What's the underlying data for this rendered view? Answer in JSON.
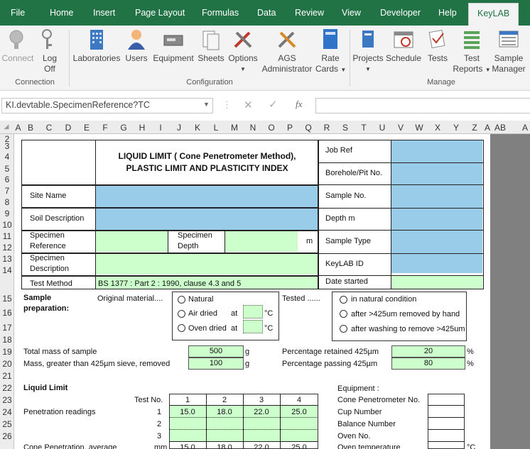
{
  "ribbon_tabs": [
    "File",
    "Home",
    "Insert",
    "Page Layout",
    "Formulas",
    "Data",
    "Review",
    "View",
    "Developer",
    "Help",
    "KeyLAB"
  ],
  "ribbon": {
    "connect": "Connect",
    "logoff_1": "Log",
    "logoff_2": "Off",
    "laboratories": "Laboratories",
    "users": "Users",
    "equipment": "Equipment",
    "sheets": "Sheets",
    "options": "Options",
    "ags_1": "AGS",
    "ags_2": "Administrator",
    "rate_1": "Rate",
    "rate_2": "Cards",
    "projects": "Projects",
    "schedule": "Schedule",
    "tests": "Tests",
    "treports_1": "Test",
    "treports_2": "Reports",
    "smanager_1": "Sample",
    "smanager_2": "Manager",
    "group_connection": "Connection",
    "group_configuration": "Configuration",
    "group_manage": "Manage"
  },
  "formula_bar": {
    "name_box": "KI.devtable.SpecimenReference?TC",
    "fx": "fx"
  },
  "columns": [
    "A",
    "B",
    "C",
    "D",
    "E",
    "F",
    "G",
    "H",
    "I",
    "J",
    "K",
    "L",
    "M",
    "N",
    "O",
    "P",
    "Q",
    "R",
    "S",
    "T",
    "U",
    "V",
    "W",
    "X",
    "Y",
    "Z",
    "A",
    "AB",
    "A"
  ],
  "rows": [
    "2",
    "3",
    "4",
    "5",
    "6",
    "7",
    "8",
    "9",
    "10",
    "11",
    "12",
    "13",
    "14",
    "15",
    "16",
    "17",
    "18",
    "19",
    "20",
    "21",
    "22",
    "23",
    "24",
    "25",
    "26"
  ],
  "sheet": {
    "title_1": "LIQUID LIMIT ( Cone Penetrometer Method),",
    "title_2": "PLASTIC LIMIT AND PLASTICITY INDEX",
    "site_name": "Site Name",
    "soil_description": "Soil Description",
    "specimen_reference_1": "Specimen",
    "specimen_reference_2": "Reference",
    "specimen_depth_1": "Specimen",
    "specimen_depth_2": "Depth",
    "depth_unit": "m",
    "specimen_description_1": "Specimen",
    "specimen_description_2": "Description",
    "test_method": "Test Method",
    "test_method_value": "BS 1377 : Part 2 : 1990, clause 4.3 and 5",
    "job_ref": "Job Ref",
    "borehole": "Borehole/Pit No.",
    "sample_no": "Sample No.",
    "depth": "Depth  m",
    "sample_type": "Sample Type",
    "keylab_id": "KeyLAB ID",
    "date_started": "Date started",
    "sample_prep_1": "Sample",
    "sample_prep_2": "preparation:",
    "original_material": "Original material....",
    "natural": "Natural",
    "air_dried": "Air dried",
    "oven_dried": "Oven dried",
    "at": "at",
    "deg_c": "°C",
    "tested": "Tested ......",
    "in_natural": "in natural condition",
    "after_425_hand": "after >425um removed by hand",
    "after_washing": "after washing to remove >425um",
    "total_mass": "Total mass of sample",
    "total_mass_value": "500",
    "g": "g",
    "mass_greater": "Mass, greater than 425µm sieve, removed",
    "mass_greater_value": "100",
    "pct_retained": "Percentage retained 425µm",
    "pct_retained_value": "20",
    "pct_passing": "Percentage passing 425µm",
    "pct_passing_value": "80",
    "pct": "%",
    "liquid_limit": "Liquid Limit",
    "test_no": "Test No.",
    "test_cols": [
      "1",
      "2",
      "3",
      "4"
    ],
    "penetration_readings": "Penetration readings",
    "readings": [
      [
        "1",
        "15.0",
        "18.0",
        "22.0",
        "25.0"
      ],
      [
        "2",
        "",
        "",
        "",
        ""
      ],
      [
        "3",
        "",
        "",
        "",
        ""
      ]
    ],
    "cone_avg": "Cone Penetration, average",
    "mm": "mm",
    "cone_avg_values": [
      "15.0",
      "18.0",
      "22.0",
      "25.0"
    ],
    "equipment": "Equipment :",
    "cone_penetrometer": "Cone Penetrometer No.",
    "cup_number": "Cup Number",
    "balance_number": "Balance Number",
    "oven_no": "Oven No.",
    "oven_temp": "Oven temperature"
  }
}
